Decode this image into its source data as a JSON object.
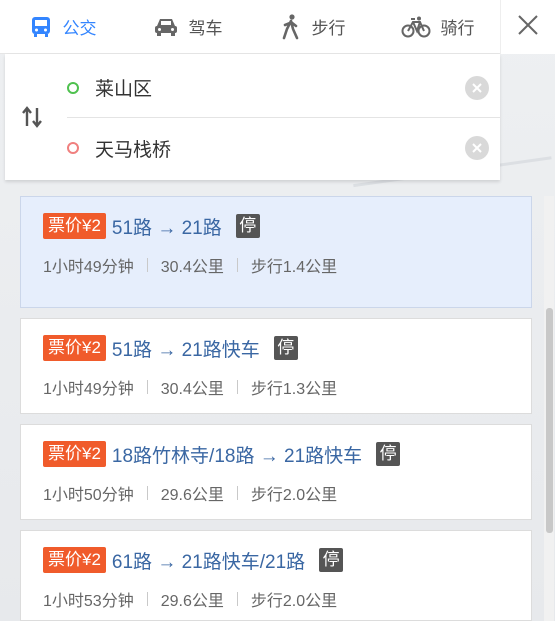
{
  "tabs": [
    {
      "label": "公交",
      "icon": "bus-icon",
      "active": true
    },
    {
      "label": "驾车",
      "icon": "car-icon",
      "active": false
    },
    {
      "label": "步行",
      "icon": "walk-icon",
      "active": false
    },
    {
      "label": "骑行",
      "icon": "bicycle-icon",
      "active": false
    }
  ],
  "route": {
    "from": "莱山区",
    "to": "天马栈桥"
  },
  "results": [
    {
      "fare": "票价¥2",
      "route": "51路 → 21路",
      "stop_badge": "停",
      "duration": "1小时49分钟",
      "distance": "30.4公里",
      "walk": "步行1.4公里",
      "selected": true
    },
    {
      "fare": "票价¥2",
      "route": "51路 → 21路快车",
      "stop_badge": "停",
      "duration": "1小时49分钟",
      "distance": "30.4公里",
      "walk": "步行1.3公里",
      "selected": false
    },
    {
      "fare": "票价¥2",
      "route": "18路竹林寺/18路 → 21路快车",
      "stop_badge": "停",
      "duration": "1小时50分钟",
      "distance": "29.6公里",
      "walk": "步行2.0公里",
      "selected": false
    },
    {
      "fare": "票价¥2",
      "route": "61路 → 21路快车/21路",
      "stop_badge": "停",
      "duration": "1小时53分钟",
      "distance": "29.6公里",
      "walk": "步行2.0公里",
      "selected": false
    }
  ],
  "colors": {
    "accent": "#3385ff",
    "fare_badge": "#f05b2b",
    "route_text": "#3a67a3",
    "selected_card": "#e6eefc"
  }
}
